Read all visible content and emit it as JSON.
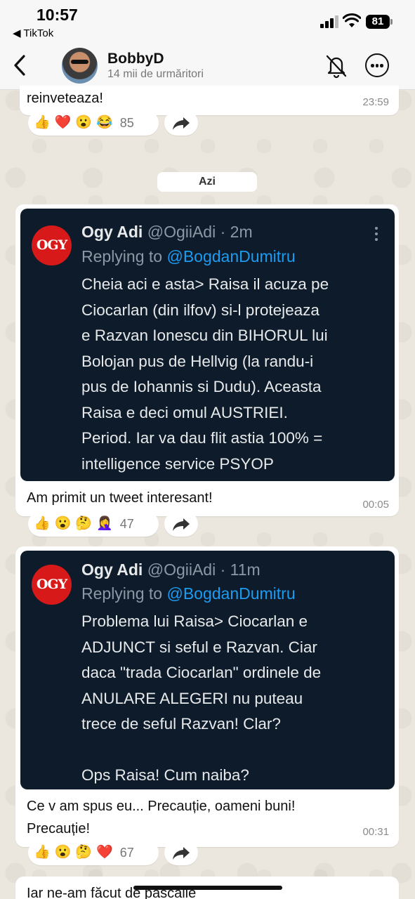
{
  "status_bar": {
    "time": "10:57",
    "back_app": "◀ TikTok",
    "battery": "81"
  },
  "header": {
    "name": "BobbyD",
    "subtitle": "14 mii de urmăritori"
  },
  "messages": [
    {
      "text": "reinveteaza!",
      "time": "23:59",
      "reactions": [
        "👍",
        "❤️",
        "😮",
        "😂"
      ],
      "reaction_count": "85"
    },
    {
      "text": "Am primit un tweet interesant!",
      "time": "00:05",
      "reactions": [
        "👍",
        "😮",
        "🤔",
        "🤦‍♀️"
      ],
      "reaction_count": "47",
      "tweet": {
        "name": "Ogy Adi",
        "handle": "@OgiiAdi · 2m",
        "replying": "Replying to",
        "mention": "@BogdanDumitru",
        "logo_text": "OGY",
        "body": "Cheia aci e asta> Raisa il acuza pe\nCiocarlan (din ilfov) si-l protejeaza\ne Razvan Ionescu din BIHORUL lui\nBolojan  pus de Hellvig (la randu-i\npus de Iohannis si Dudu). Aceasta\nRaisa e deci omul AUSTRIEI.\nPeriod. Iar va dau flit astia 100% =\nintelligence service PSYOP"
      }
    },
    {
      "text": "Ce v am spus eu... Precauție, oameni buni!\nPrecauție!",
      "time": "00:31",
      "reactions": [
        "👍",
        "😮",
        "🤔",
        "❤️"
      ],
      "reaction_count": "67",
      "tweet": {
        "name": "Ogy Adi",
        "handle": "@OgiiAdi · 11m",
        "replying": "Replying to",
        "mention": "@BogdanDumitru",
        "logo_text": "OGY",
        "body": "Problema lui Raisa> Ciocarlan e\nADJUNCT si seful e Razvan. Ciar\ndaca \"trada Ciocarlan\" ordinele de\nANULARE ALEGERI nu puteau\ntrece de seful Razvan! Clar?\n\nOps Raisa! Cum naiba?"
      }
    },
    {
      "text": "Iar ne-am făcut de pascalie"
    }
  ],
  "date_separator": "Azi",
  "colors": {
    "tweet_bg": "#0d1b2a",
    "mention": "#1d9bf0",
    "logo": "#d81919"
  },
  "icons": [
    "back-chevron-icon",
    "bell-off-icon",
    "more-options-icon",
    "share-icon"
  ]
}
